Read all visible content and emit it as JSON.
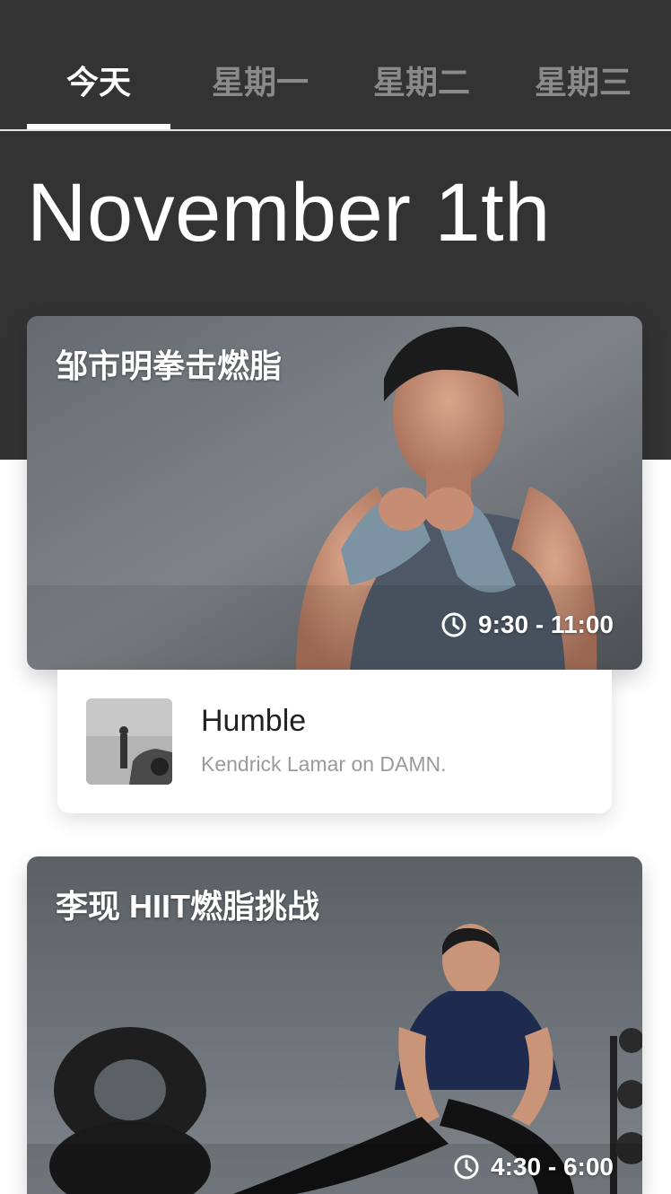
{
  "tabs": [
    {
      "label": "今天",
      "active": true
    },
    {
      "label": "星期一",
      "active": false
    },
    {
      "label": "星期二",
      "active": false
    },
    {
      "label": "星期三",
      "active": false
    }
  ],
  "date_heading": "November 1th",
  "classes": [
    {
      "title": "邹市明拳击燃脂",
      "time": "9:30 - 11:00"
    },
    {
      "title": "李现 HIIT燃脂挑战",
      "time": "4:30 - 6:00"
    }
  ],
  "music": {
    "title": "Humble",
    "subtitle": "Kendrick Lamar on DAMN."
  },
  "colors": {
    "header_bg": "#333333",
    "active_tab": "#ffffff",
    "inactive_tab": "#8a8a8a"
  }
}
